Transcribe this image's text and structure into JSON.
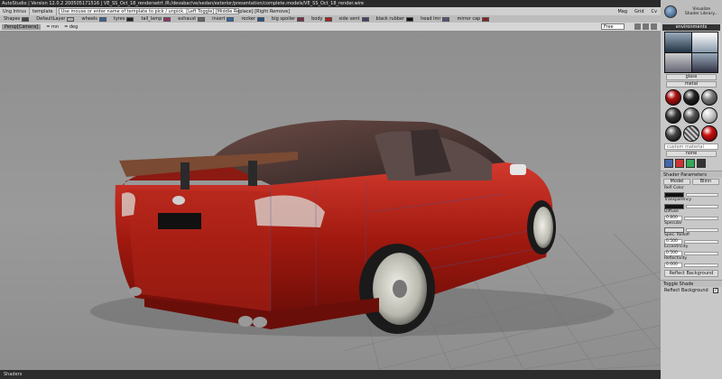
{
  "window": {
    "title": "AutoStudio | Version 12.0.2 200505171516 | VE_SS_Oct_18_rendersetrt /R:/devabar/ve/sedan/exterior/presentation/complete.models/VE_SS_Oct_18_render.wire"
  },
  "toolbar": {
    "item1": "Ung Intrus",
    "item2": "template",
    "template_input": "Use mouse or enter name of template to pick / unpick. [Left Toggle] [Middle Replace] [Right Remove]",
    "menus": [
      "Mag",
      "Grid",
      "Cv"
    ]
  },
  "shaders": [
    {
      "label": "Shapes",
      "color": "#444444"
    },
    {
      "label": "DefaultLayer",
      "color": "#b0b0b0"
    },
    {
      "label": "wheels",
      "color": "#336699"
    },
    {
      "label": "tyres",
      "color": "#222222"
    },
    {
      "label": "tail_lamp",
      "color": "#993366"
    },
    {
      "label": "exhaust",
      "color": "#666666"
    },
    {
      "label": "insert",
      "color": "#3366aa"
    },
    {
      "label": "rocker",
      "color": "#225588"
    },
    {
      "label": "big spoiler",
      "color": "#773344"
    },
    {
      "label": "body",
      "color": "#aa2222"
    },
    {
      "label": "side vent",
      "color": "#444466"
    },
    {
      "label": "black rubber",
      "color": "#111111"
    },
    {
      "label": "head lmr",
      "color": "#555577"
    },
    {
      "label": "mirror cap",
      "color": "#882222"
    }
  ],
  "viewport": {
    "camera_label": "Persp[Camera]",
    "near_label": "= mn",
    "deg_label": "= deg",
    "field_label": "Free"
  },
  "statusbar": {
    "label": "Shaders"
  },
  "shader_panel": {
    "visualize_label": "Visualize",
    "library_label": "Shader Library...",
    "environments_label": "environments",
    "glass_label": "glass",
    "metal_label": "metal",
    "material_field": "custom material",
    "none_label": "none",
    "parameters_title": "Shader Parameters",
    "tabs": [
      "Model",
      "Blinn"
    ],
    "params": [
      {
        "label": "Refl Color",
        "value": ""
      },
      {
        "label": "Transparency",
        "value": ""
      },
      {
        "label": "Diffuse",
        "value": "0.800"
      },
      {
        "label": "Specular",
        "value": ""
      },
      {
        "label": "Spec. Rolloff",
        "value": "0.500"
      },
      {
        "label": "Eccentricity",
        "value": "0.500"
      },
      {
        "label": "Reflectivity",
        "value": "0.000"
      }
    ],
    "reflect_background": "Reflect Background",
    "toggle_shade": "Toggle Shade",
    "reflect_bg_toggle": "Reflect Background",
    "checkmark": "✓"
  }
}
